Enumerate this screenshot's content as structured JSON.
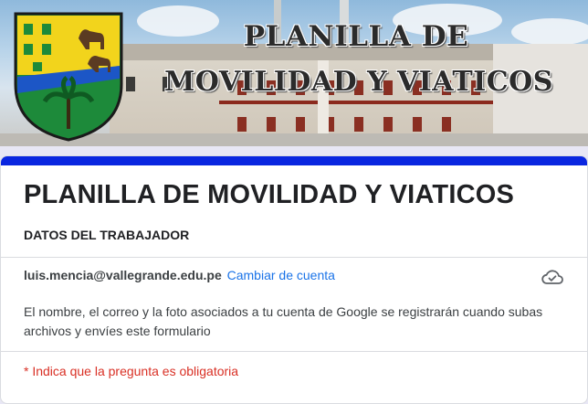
{
  "banner": {
    "title_line1": "PLANILLA DE",
    "title_line2": "MOVILIDAD Y VIATICOS"
  },
  "form": {
    "title": "PLANILLA DE MOVILIDAD Y VIATICOS",
    "section": "DATOS DEL TRABAJADOR",
    "account_email": "luis.mencia@vallegrande.edu.pe",
    "switch_account": "Cambiar de cuenta",
    "info": "El nombre, el correo y la foto asociados a tu cuenta de Google se registrarán cuando subas archivos y envíes este formulario",
    "required_note": "* Indica que la pregunta es obligatoria"
  },
  "colors": {
    "accent": "#0a26e0",
    "link": "#1a73e8",
    "required": "#d93025"
  },
  "icons": {
    "cloud_status": "cloud-done-icon",
    "crest": "school-crest"
  }
}
